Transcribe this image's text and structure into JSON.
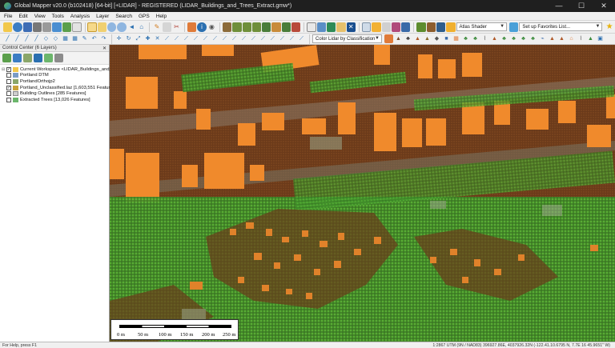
{
  "window": {
    "title": "Global Mapper v20.0 (b102418) [64-bit] [+LIDAR] - REGISTERED (LIDAR_Buildings_and_Trees_Extract.gmw*)",
    "minimize": "—",
    "maximize": "☐",
    "close": "✕"
  },
  "menu": [
    "File",
    "Edit",
    "View",
    "Tools",
    "Analysis",
    "Layer",
    "Search",
    "GPS",
    "Help"
  ],
  "toolbar1": {
    "shader_select": "Atlas Shader",
    "favorites_select": "Set up Favorites List..."
  },
  "toolbar2": {
    "lidar_color_select": "Color Lidar by Classification"
  },
  "control_center": {
    "title": "Control Center (6 Layers)",
    "close": "✕",
    "workspace": "Current Workspace <LIDAR_Buildings_and_Trees_...",
    "layers": [
      {
        "label": "Portland DTM",
        "checked": false,
        "icon_color": "#7a9cc6"
      },
      {
        "label": "PortlandOrthojp2",
        "checked": false,
        "icon_color": "#8aa66a"
      },
      {
        "label": "Portland_Unclassified.laz [1,603,551 Features]",
        "checked": true,
        "icon_color": "#c9a23a"
      },
      {
        "label": "Building Outlines [285 Features]",
        "checked": false,
        "icon_color": "#d0d0d0"
      },
      {
        "label": "Extracted Trees [13,026 Features]",
        "checked": false,
        "icon_color": "#6cb66c"
      }
    ]
  },
  "scale_bar": {
    "labels": [
      "0 m",
      "50 m",
      "100 m",
      "150 m",
      "200 m",
      "250 m"
    ]
  },
  "status": {
    "left": "For Help, press F1",
    "right": "1:2867  UTM (9N / NAD83)  396927.86E, 4037926.32N  (-122.41.10.6795 N, 7.7E 16 45.9651\" W)"
  },
  "icons": {
    "title_app": "global-mapper-icon",
    "tb1": [
      "open-folder-icon",
      "open-globe-icon",
      "save-icon",
      "print-icon",
      "settings-icon",
      "config-icon",
      "control-center-icon",
      "select-icon",
      "pan-icon",
      "zoom-in-icon",
      "zoom-out-icon",
      "back-icon",
      "home-icon",
      "digitize-icon",
      "edit-icon",
      "measure-icon",
      "info-icon",
      "path-profile-icon",
      "terrain-icon",
      "3d-view-icon",
      "lidar-tool-icon",
      "shader-icon",
      "layer-icon",
      "close-layer-icon"
    ],
    "tb2": [
      "line-tool-icon",
      "area-tool-icon",
      "point-tool-icon",
      "move-icon",
      "rotate-icon",
      "scale-icon",
      "split-icon",
      "join-icon",
      "vertex-icon",
      "snap-icon",
      "feature-info-icon",
      "buffer-icon",
      "crop-icon",
      "tree-classify-icon",
      "building-classify-icon",
      "lidar-filter-icon"
    ]
  }
}
